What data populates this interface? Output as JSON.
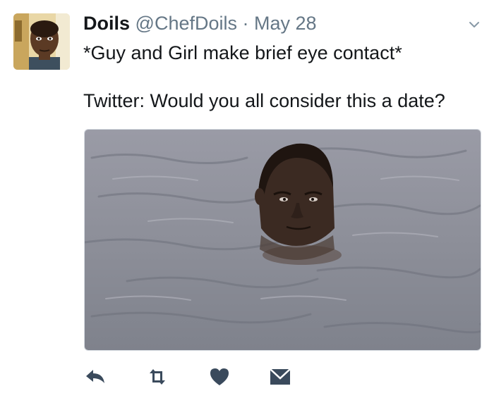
{
  "tweet": {
    "author_name": "Doils",
    "author_handle": "@ChefDoils",
    "separator": "·",
    "date": "May 28",
    "text_line1": "*Guy and Girl make brief eye contact*",
    "text_line2": "Twitter: Would you all consider this a date?"
  },
  "icons": {
    "menu": "chevron-down-icon",
    "reply": "reply-icon",
    "retweet": "retweet-icon",
    "like": "heart-icon",
    "message": "envelope-icon"
  },
  "colors": {
    "text": "#14171a",
    "muted": "#657786",
    "icon": "#3a4a5c",
    "water": "#8a8f99"
  }
}
